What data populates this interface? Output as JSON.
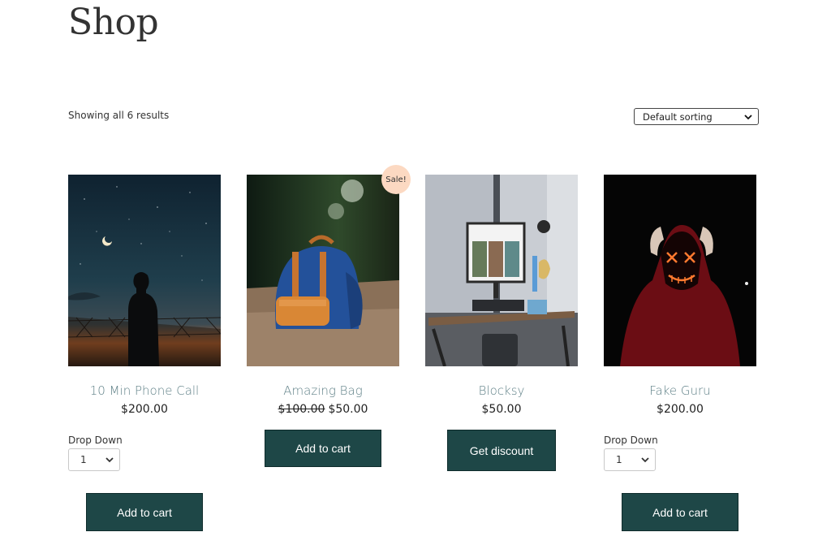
{
  "page": {
    "title": "Shop"
  },
  "toolbar": {
    "result_count": "Showing all 6 results",
    "sorting": {
      "selected": "Default sorting"
    }
  },
  "products": [
    {
      "title": "10 Min Phone Call",
      "price": "$200.00",
      "dropdown_label": "Drop Down",
      "dropdown_value": "1",
      "button": "Add to cart"
    },
    {
      "title": "Amazing Bag",
      "badge": "Sale!",
      "old_price": "$100.00",
      "price": "$50.00",
      "button": "Add to cart"
    },
    {
      "title": "Blocksy",
      "price": "$50.00",
      "button": "Get discount"
    },
    {
      "title": "Fake Guru",
      "price": "$200.00",
      "dropdown_label": "Drop Down",
      "dropdown_value": "1",
      "button": "Add to cart"
    }
  ],
  "colors": {
    "button_bg": "#1e4747",
    "title_link": "#5f8087",
    "sale_badge": "#fcd9c2"
  }
}
